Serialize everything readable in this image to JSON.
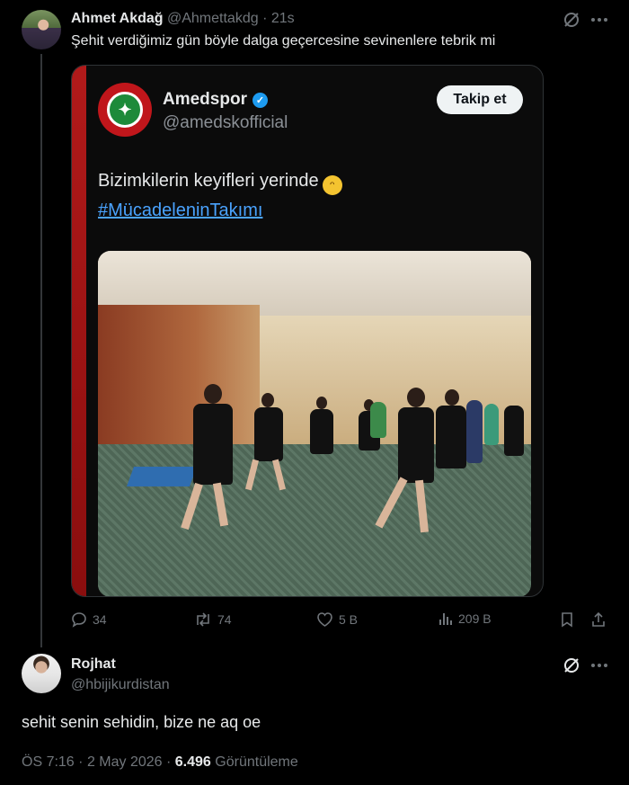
{
  "tweet": {
    "author_name": "Ahmet Akdağ",
    "author_handle": "@Ahmettakdg",
    "separator": "·",
    "time": "21s",
    "text": "Şehit verdiğimiz gün böyle dalga geçercesine sevinenlere tebrik mi",
    "quoted": {
      "name": "Amedspor",
      "handle": "@amedskofficial",
      "follow_label": "Takip et",
      "text": "Bizimkilerin keyifleri yerinde",
      "hashtag": "#MücadeleninTakımı"
    },
    "stats": {
      "replies": "34",
      "reposts": "74",
      "likes": "5 B",
      "views": "209 B"
    }
  },
  "reply": {
    "author_name": "Rojhat",
    "author_handle": "@hbijikurdistan",
    "text": "sehit senin sehidin, bize ne aq oe",
    "time": "ÖS 7:16",
    "date": "2 May 2026",
    "views_count": "6.496",
    "views_label": "Görüntüleme"
  },
  "icons": {
    "grok": "grok-icon",
    "more": "more-icon",
    "reply": "reply-icon",
    "repost": "repost-icon",
    "like": "heart-icon",
    "views": "views-icon",
    "bookmark": "bookmark-icon",
    "share": "share-icon",
    "verified": "verified-badge-icon"
  },
  "colors": {
    "background": "#000000",
    "text_primary": "#e7e9ea",
    "text_secondary": "#71767b",
    "accent_blue": "#1d9bf0",
    "amedspor_red": "#c0161b"
  }
}
